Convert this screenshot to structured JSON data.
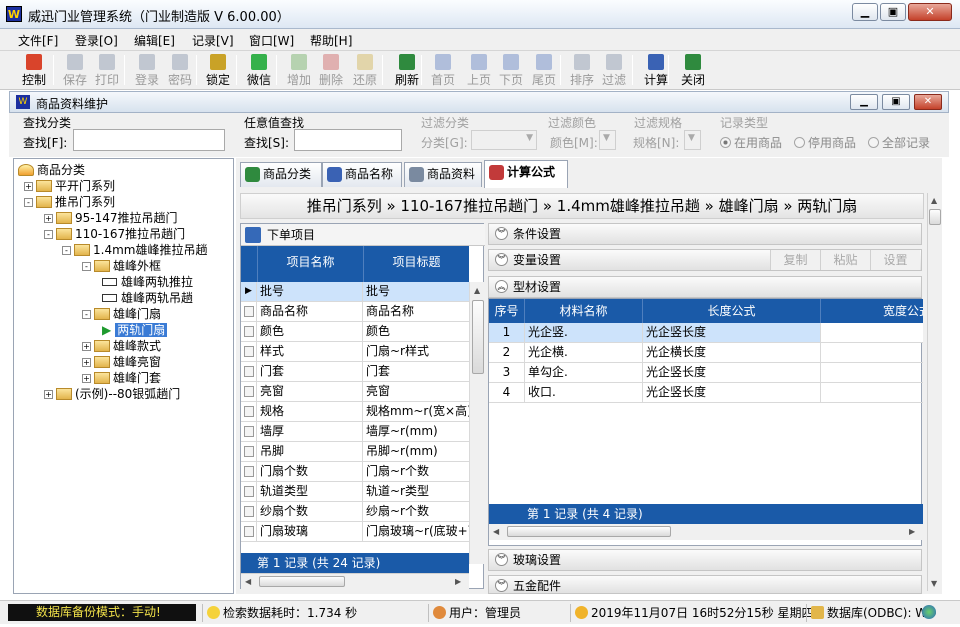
{
  "window": {
    "title": "威迅门业管理系统（门业制造版 V 6.00.00）",
    "app_icon": "W"
  },
  "menu": [
    "文件[F]",
    "登录[O]",
    "编辑[E]",
    "记录[V]",
    "窗口[W]",
    "帮助[H]"
  ],
  "toolbar": [
    {
      "label": "控制",
      "icon": "grid-icon",
      "enabled": true,
      "color": "#d9442b"
    },
    {
      "label": "保存",
      "icon": "save-icon",
      "enabled": false,
      "color": "#6a7c99"
    },
    {
      "label": "打印",
      "icon": "print-icon",
      "enabled": false,
      "color": "#6a7c99"
    },
    {
      "label": "登录",
      "icon": "login-icon",
      "enabled": false,
      "color": "#6a7c99"
    },
    {
      "label": "密码",
      "icon": "key-icon",
      "enabled": false,
      "color": "#6a7c99"
    },
    {
      "label": "锁定",
      "icon": "lock-icon",
      "enabled": true,
      "color": "#c9a227"
    },
    {
      "label": "微信",
      "icon": "wechat-icon",
      "enabled": true,
      "color": "#35b14b"
    },
    {
      "label": "增加",
      "icon": "add-icon",
      "enabled": false,
      "color": "#4a9a3a"
    },
    {
      "label": "删除",
      "icon": "delete-icon",
      "enabled": false,
      "color": "#c23a3a"
    },
    {
      "label": "还原",
      "icon": "undo-icon",
      "enabled": false,
      "color": "#c9a227"
    },
    {
      "label": "刷新",
      "icon": "refresh-icon",
      "enabled": true,
      "color": "#2f8a3e"
    },
    {
      "label": "首页",
      "icon": "first-icon",
      "enabled": false,
      "color": "#3a62b4"
    },
    {
      "label": "上页",
      "icon": "prev-icon",
      "enabled": false,
      "color": "#3a62b4"
    },
    {
      "label": "下页",
      "icon": "next-icon",
      "enabled": false,
      "color": "#3a62b4"
    },
    {
      "label": "尾页",
      "icon": "last-icon",
      "enabled": false,
      "color": "#3a62b4"
    },
    {
      "label": "排序",
      "icon": "sort-icon",
      "enabled": false,
      "color": "#6a7c99"
    },
    {
      "label": "过滤",
      "icon": "filter-icon",
      "enabled": false,
      "color": "#6a7c99"
    },
    {
      "label": "计算",
      "icon": "calculator-icon",
      "enabled": true,
      "color": "#3a62b4"
    },
    {
      "label": "关闭",
      "icon": "exit-icon",
      "enabled": true,
      "color": "#2f8a3e"
    }
  ],
  "child_window": {
    "title": "商品资料维护"
  },
  "filters": {
    "category_group": "查找分类",
    "category_label": "查找[F]:",
    "category_value": "",
    "anyvalue_group": "任意值查找",
    "anyvalue_label": "查找[S]:",
    "anyvalue_value": "",
    "filter_cat_group": "过滤分类",
    "filter_cat_label": "分类[G]:",
    "filter_color_group": "过滤颜色",
    "filter_color_label": "颜色[M]:",
    "filter_spec_group": "过滤规格",
    "filter_spec_label": "规格[N]:",
    "record_type_group": "记录类型",
    "radios": [
      {
        "label": "在用商品",
        "checked": true
      },
      {
        "label": "停用商品",
        "checked": false
      },
      {
        "label": "全部记录",
        "checked": false
      }
    ]
  },
  "tree": [
    {
      "label": "商品分类",
      "level": 0,
      "type": "root"
    },
    {
      "label": "平开门系列",
      "level": 1,
      "type": "folder",
      "expander": "+"
    },
    {
      "label": "推吊门系列",
      "level": 1,
      "type": "folder",
      "expander": "-"
    },
    {
      "label": "95-147推拉吊趟门",
      "level": 2,
      "type": "folder",
      "expander": "+"
    },
    {
      "label": "110-167推拉吊趟门",
      "level": 2,
      "type": "folder",
      "expander": "-"
    },
    {
      "label": "1.4mm雄峰推拉吊趟",
      "level": 3,
      "type": "folder",
      "expander": "-"
    },
    {
      "label": "雄峰外框",
      "level": 4,
      "type": "folder",
      "expander": "-"
    },
    {
      "label": "雄峰两轨推拉",
      "level": 5,
      "type": "door"
    },
    {
      "label": "雄峰两轨吊趟",
      "level": 5,
      "type": "door"
    },
    {
      "label": "雄峰门扇",
      "level": 4,
      "type": "folder",
      "expander": "-"
    },
    {
      "label": "两轨门扇",
      "level": 5,
      "type": "selected"
    },
    {
      "label": "雄峰款式",
      "level": 4,
      "type": "folder",
      "expander": "+"
    },
    {
      "label": "雄峰亮窗",
      "level": 4,
      "type": "folder",
      "expander": "+"
    },
    {
      "label": "雄峰门套",
      "level": 4,
      "type": "folder",
      "expander": "+"
    },
    {
      "label": "(示例)--80银弧趟门",
      "level": 2,
      "type": "folder",
      "expander": "+"
    }
  ],
  "tabs": [
    {
      "label": "商品分类",
      "icon": "category-icon",
      "active": false
    },
    {
      "label": "商品名称",
      "icon": "name-icon",
      "active": false
    },
    {
      "label": "商品资料",
      "icon": "info-icon",
      "active": false
    },
    {
      "label": "计算公式",
      "icon": "formula-icon",
      "active": true
    }
  ],
  "breadcrumb": "推吊门系列 » 110-167推拉吊趟门 » 1.4mm雄峰推拉吊趟 » 雄峰门扇 » 两轨门扇",
  "order_items": {
    "title": "下单项目",
    "columns": [
      "项目名称",
      "项目标题"
    ],
    "rows": [
      [
        "批号",
        "批号"
      ],
      [
        "商品名称",
        "商品名称"
      ],
      [
        "颜色",
        "颜色"
      ],
      [
        "样式",
        "门扇~r样式"
      ],
      [
        "门套",
        "门套"
      ],
      [
        "亮窗",
        "亮窗"
      ],
      [
        "规格",
        "规格mm~r(宽×高)"
      ],
      [
        "墙厚",
        "墙厚~r(mm)"
      ],
      [
        "吊脚",
        "吊脚~r(mm)"
      ],
      [
        "门扇个数",
        "门扇~r个数"
      ],
      [
        "轨道类型",
        "轨道~r类型"
      ],
      [
        "纱扇个数",
        "纱扇~r个数"
      ],
      [
        "门扇玻璃",
        "门扇玻璃~r(底玻+面"
      ]
    ],
    "footer": "第 1 记录 (共 24 记录)"
  },
  "sections": {
    "condition": "条件设置",
    "variable": "变量设置",
    "profile": "型材设置",
    "glass": "玻璃设置",
    "hardware": "五金配件",
    "copy_btn": "复制",
    "paste_btn": "粘贴",
    "settings_btn": "设置"
  },
  "materials": {
    "columns": [
      "序号",
      "材料名称",
      "长度公式",
      "宽度公式"
    ],
    "rows": [
      [
        "1",
        "光企竖.",
        "光企竖长度"
      ],
      [
        "2",
        "光企横.",
        "光企横长度"
      ],
      [
        "3",
        "单勾企.",
        "光企竖长度"
      ],
      [
        "4",
        "收口.",
        "光企竖长度"
      ]
    ],
    "footer": "第 1 记录 (共 4 记录)"
  },
  "status": {
    "backup": "数据库备份模式：手动!",
    "search_time": "检索数据耗时：1.734 秒",
    "user": "用户：管理员",
    "datetime": "2019年11月07日  16时52分15秒  星期四",
    "database": "数据库(ODBC): WO"
  },
  "colors": {
    "grid_header": "#1a5aa8",
    "selection": "#cde3fb",
    "tree_selection": "#3a7bd5"
  }
}
